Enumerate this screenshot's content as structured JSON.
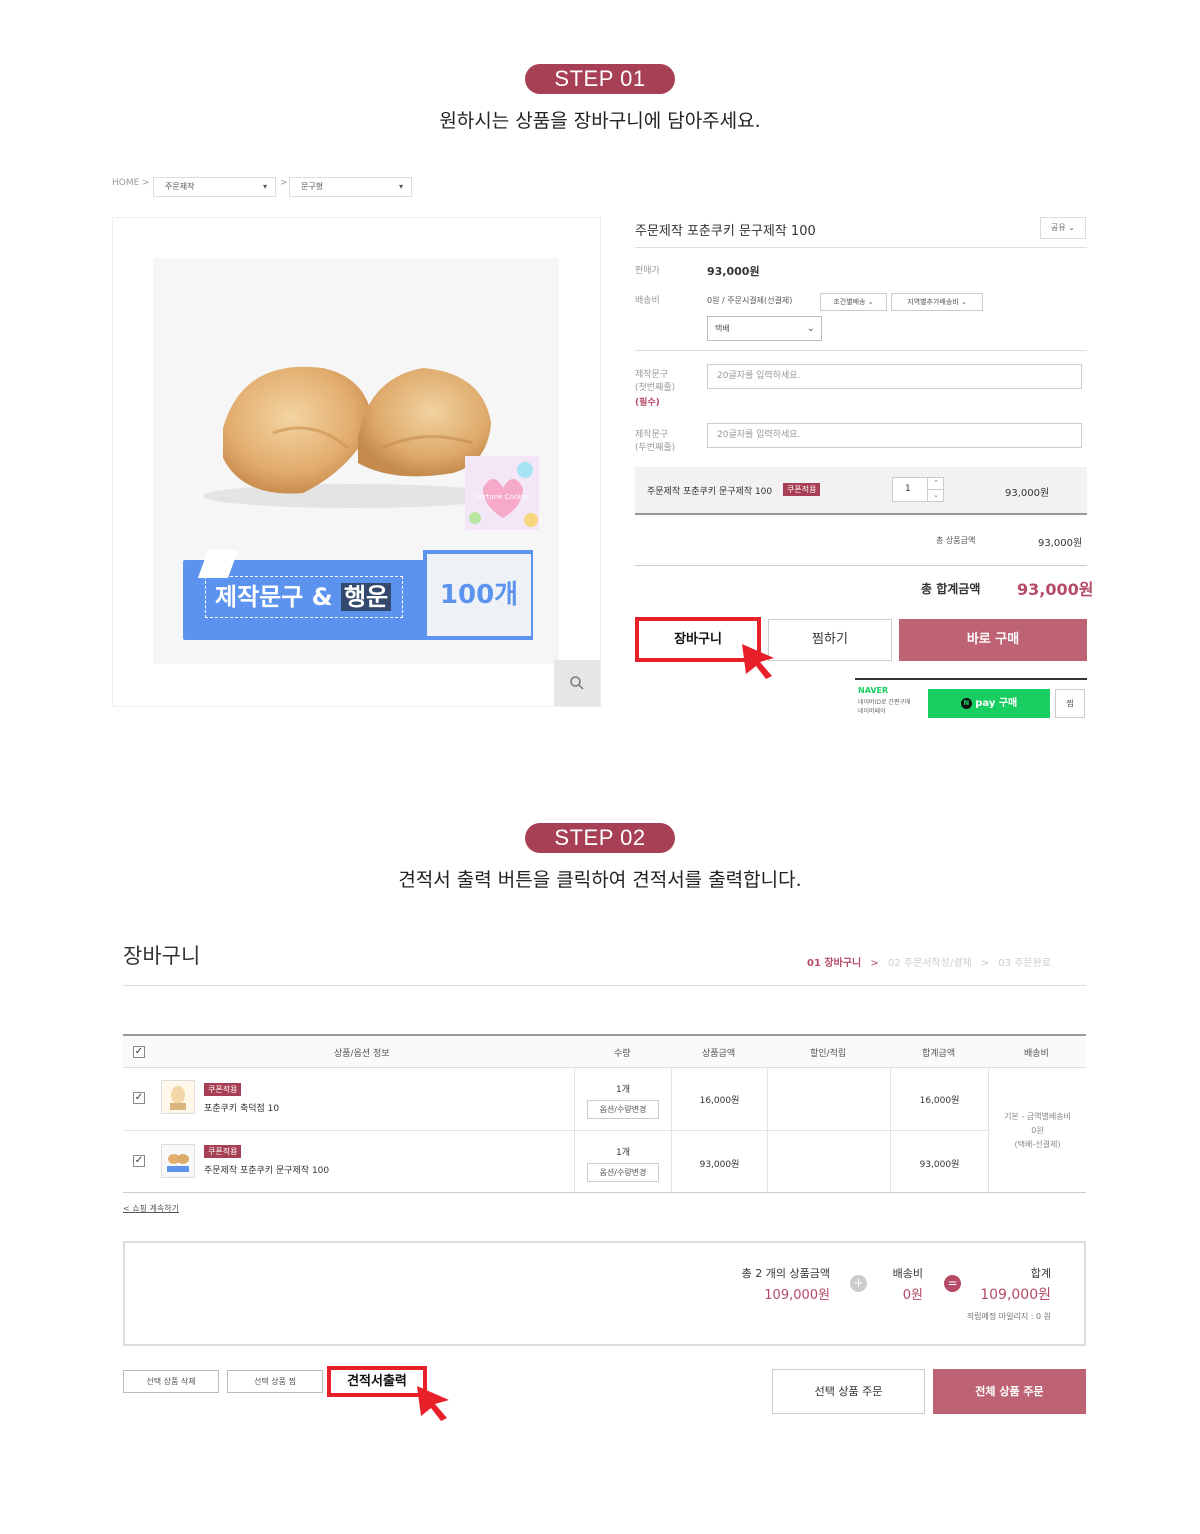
{
  "step1": {
    "pill": "STEP 01",
    "desc": "원하시는 상품을 장바구니에 담아주세요."
  },
  "breadcrumb": {
    "home": "HOME",
    "cat1": "주문제작",
    "cat2": "문구형"
  },
  "image": {
    "banner_text": "제작문구 & 행운",
    "banner_highlight": "행운",
    "banner_count": "100개",
    "card_text": "Fortune Cookie"
  },
  "product": {
    "title": "주문제작 포춘쿠키 문구제작 100",
    "share": "공유",
    "price_label": "판매가",
    "price": "93,000원",
    "ship_label": "배송비",
    "ship_value": "0원  / 주문시결제(선결제)",
    "ship_opt1": "조건별배송",
    "ship_opt2": "지역별추가배송비",
    "ship_select": "택배",
    "msg1_label": "제작문구\n(첫번째줄)",
    "msg1_required": "(필수)",
    "msg1_placeholder": "20글자를 입력하세요.",
    "msg2_label": "제작문구\n(두번째줄)",
    "msg2_placeholder": "20글자를 입력하세요.",
    "line_name": "주문제작 포춘쿠키 문구제작 100",
    "line_badge": "쿠폰적용",
    "line_qty": "1",
    "line_price": "93,000원",
    "subtotal_label": "총 상품금액",
    "subtotal": "93,000원",
    "total_label": "총 합계금액",
    "total": "93,000원",
    "cart_btn": "장바구니",
    "wish_btn": "찜하기",
    "buy_btn": "바로 구매",
    "naver": "NAVER",
    "naver_sub1": "네이버ID로 간편구매",
    "naver_sub2": "네이버페이",
    "npay": "pay 구매",
    "npay_n": "N",
    "npay_wish": "찜"
  },
  "step2": {
    "pill": "STEP 02",
    "desc": "견적서 출력 버튼을 클릭하여 견적서를 출력합니다."
  },
  "cart": {
    "title": "장바구니",
    "steps": [
      "01 장바구니",
      "02 주문서작성/결제",
      "03 주문완료"
    ],
    "headers": [
      "상품/옵션 정보",
      "수량",
      "상품금액",
      "할인/적립",
      "합계금액",
      "배송비"
    ],
    "rows": [
      {
        "badge": "쿠폰적용",
        "name": "포춘쿠키 축덕점 10",
        "qty": "1개",
        "opt": "옵션/수량변경",
        "price": "16,000원",
        "total": "16,000원"
      },
      {
        "badge": "쿠폰적용",
        "name": "주문제작 포춘쿠키 문구제작 100",
        "qty": "1개",
        "opt": "옵션/수량변경",
        "price": "93,000원",
        "total": "93,000원"
      }
    ],
    "ship_info1": "기본 - 금액별배송비",
    "ship_info2": "0원",
    "ship_info3": "(택배-선결제)",
    "continue": "< 쇼핑 계속하기",
    "sum_label": "총 2 개의 상품금액",
    "sum_value": "109,000원",
    "ship_label": "배송비",
    "ship_value": "0원",
    "total_label": "합계",
    "total_value": "109,000원",
    "mileage": "적립예정 마일리지 : 0 원",
    "plus": "+",
    "equals": "=",
    "btn_delete": "선택 상품 삭제",
    "btn_wish": "선택 상품 찜",
    "btn_estimate": "견적서출력",
    "btn_order_sel": "선택 상품 주문",
    "btn_order_all": "전체 상품 주문"
  },
  "colors": {
    "accent": "#a84055",
    "buy": "#bd6373",
    "highlight": "#e8202a",
    "npay": "#19ce60",
    "banner": "#5b93ee"
  }
}
